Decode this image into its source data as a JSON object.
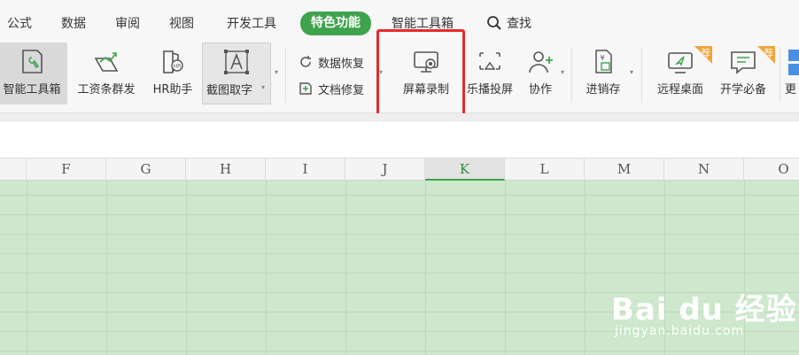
{
  "menu": {
    "tabs": [
      "公式",
      "数据",
      "审阅",
      "视图",
      "开发工具",
      "特色功能",
      "智能工具箱"
    ],
    "active_tab": "特色功能",
    "search_label": "查找"
  },
  "ribbon": {
    "buttons": [
      {
        "label": "智能工具箱",
        "icon": "smart-toolbox-icon"
      },
      {
        "label": "工资条群发",
        "icon": "payslip-send-icon"
      },
      {
        "label": "HR助手",
        "icon": "hr-assistant-icon"
      },
      {
        "label": "截图取字",
        "icon": "ocr-text-icon"
      },
      {
        "label": "屏幕录制",
        "icon": "screen-record-icon"
      },
      {
        "label": "乐播投屏",
        "icon": "cast-screen-icon"
      },
      {
        "label": "协作",
        "icon": "add-user-icon"
      },
      {
        "label": "进销存",
        "icon": "inventory-icon"
      },
      {
        "label": "远程桌面",
        "icon": "remote-desktop-icon"
      },
      {
        "label": "开学必备",
        "icon": "school-essentials-icon"
      },
      {
        "label": "更",
        "icon": "more-icon"
      }
    ],
    "small_buttons": [
      {
        "label": "数据恢复",
        "icon": "data-recovery-icon"
      },
      {
        "label": "文档修复",
        "icon": "doc-repair-icon"
      }
    ],
    "badge_label": "荐"
  },
  "columns": [
    "F",
    "G",
    "H",
    "I",
    "J",
    "K",
    "L",
    "M",
    "N",
    "O"
  ],
  "active_column": "K",
  "watermark": {
    "main": "Bai du 经验",
    "sub": "jingyan.baidu.com"
  },
  "colors": {
    "accent": "#3fa34d",
    "highlight": "#e62b2b",
    "grid_fill": "#cde8cd",
    "badge": "#f2a33a"
  }
}
